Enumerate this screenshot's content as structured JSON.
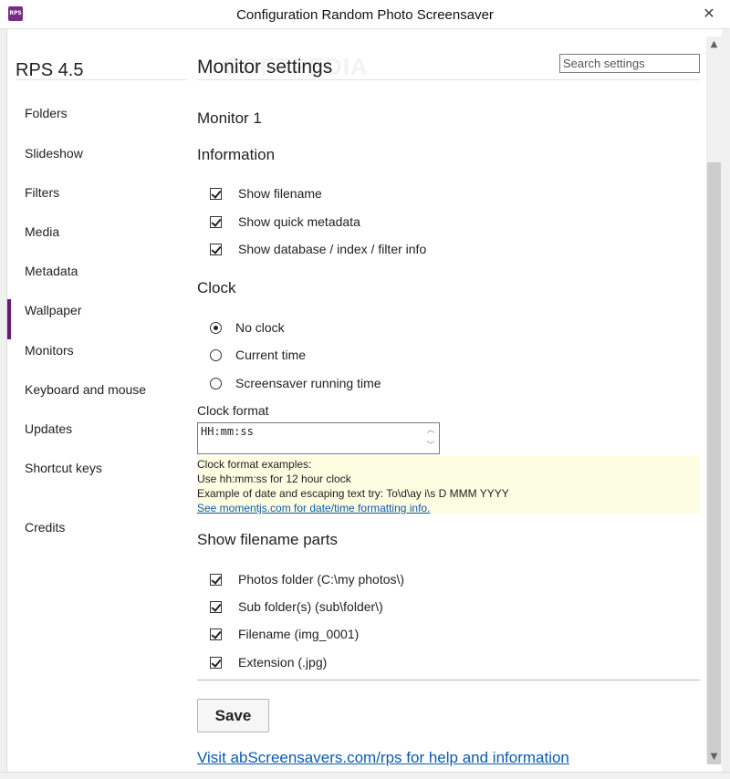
{
  "window": {
    "title": "Configuration Random Photo Screensaver",
    "icon_text": "RPS",
    "close_glyph": "✕"
  },
  "sidebar": {
    "app_name": "RPS 4.5",
    "items": [
      {
        "label": "Folders",
        "active": false
      },
      {
        "label": "Slideshow",
        "active": false
      },
      {
        "label": "Filters",
        "active": false
      },
      {
        "label": "Media",
        "active": false
      },
      {
        "label": "Metadata",
        "active": false
      },
      {
        "label": "Wallpaper",
        "active": false
      },
      {
        "label": "Monitors",
        "active": true
      },
      {
        "label": "Keyboard and mouse",
        "active": false
      },
      {
        "label": "Updates",
        "active": false
      },
      {
        "label": "Shortcut keys",
        "active": false
      },
      {
        "label": "Credits",
        "active": false
      }
    ]
  },
  "header": {
    "title": "Monitor settings",
    "search_placeholder": "Search settings",
    "watermark": "SOFTPEDIA"
  },
  "monitor": {
    "heading": "Monitor 1"
  },
  "information": {
    "heading": "Information",
    "options": [
      {
        "label": "Show filename",
        "checked": true
      },
      {
        "label": "Show quick metadata",
        "checked": true
      },
      {
        "label": "Show database / index / filter info",
        "checked": true
      }
    ]
  },
  "clock": {
    "heading": "Clock",
    "options": [
      {
        "label": "No clock",
        "selected": true
      },
      {
        "label": "Current time",
        "selected": false
      },
      {
        "label": "Screensaver running time",
        "selected": false
      }
    ],
    "format_label": "Clock format",
    "format_value": "HH:mm:ss",
    "help_lines": [
      "Clock format examples:",
      "Use hh:mm:ss for 12 hour clock",
      "Example of date and escaping text try: To\\d\\ay i\\s D MMM YYYY"
    ],
    "help_link": "See momentjs.com for date/time formatting info."
  },
  "filename_parts": {
    "heading": "Show filename parts",
    "options": [
      {
        "label": "Photos folder (C:\\my photos\\)",
        "checked": true
      },
      {
        "label": "Sub folder(s) (sub\\folder\\)",
        "checked": true
      },
      {
        "label": "Filename (img_0001)",
        "checked": true
      },
      {
        "label": "Extension (.jpg)",
        "checked": true
      }
    ]
  },
  "footer": {
    "save_label": "Save",
    "help_link": "Visit abScreensavers.com/rps for help and information"
  },
  "scrollbar": {
    "up_glyph": "▲",
    "down_glyph": "▼"
  },
  "colors": {
    "accent": "#6a1b7a",
    "link": "#0a5bb5",
    "help_bg": "#fdfde2"
  }
}
